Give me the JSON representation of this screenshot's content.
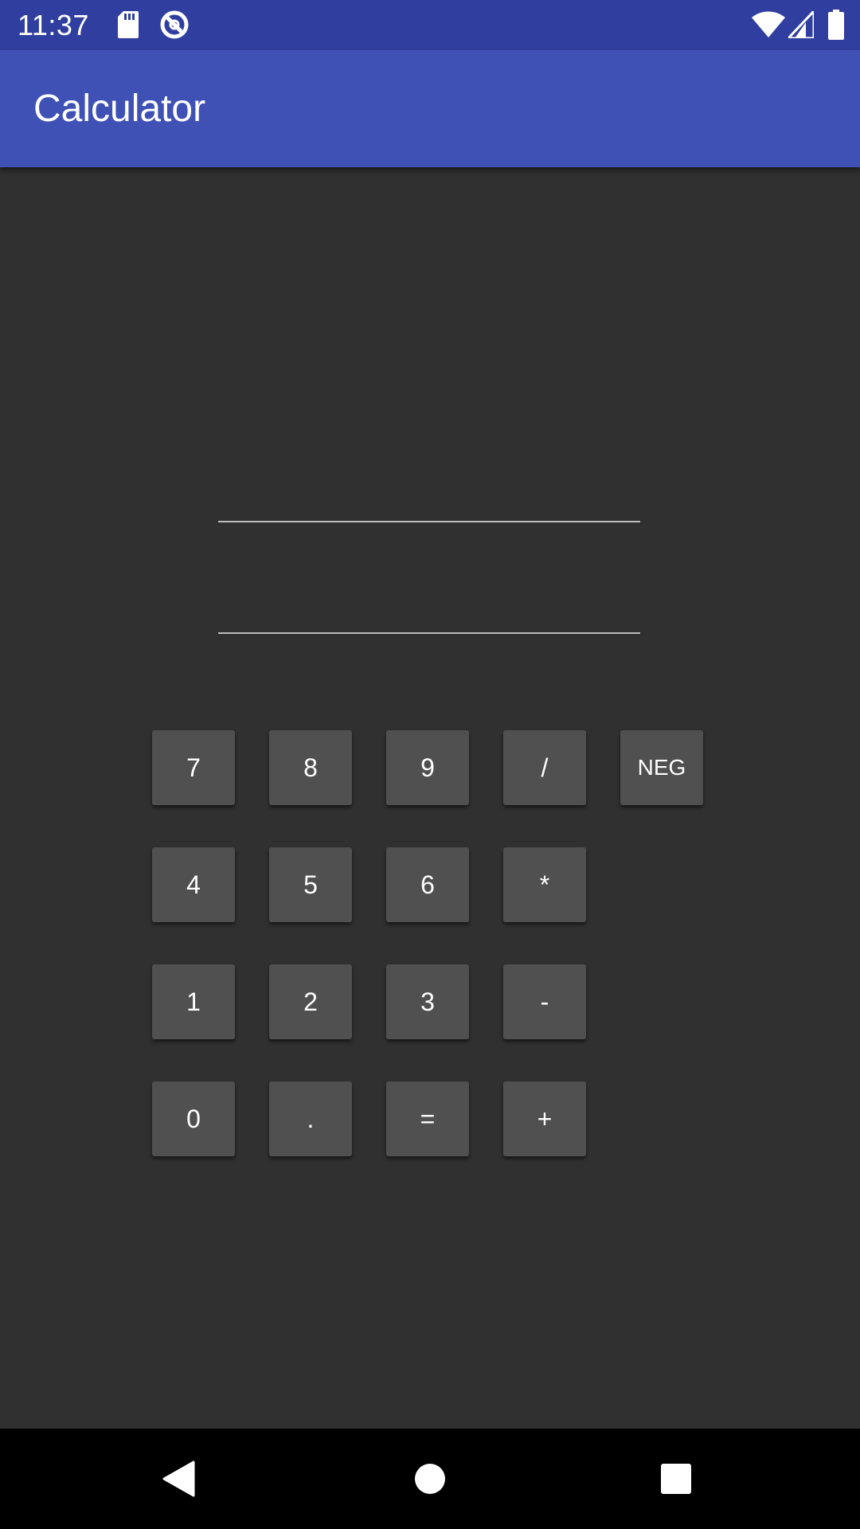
{
  "status_bar": {
    "time": "11:37",
    "icons": [
      "sd-card-icon",
      "do-not-disturb-icon",
      "wifi-icon",
      "cell-signal-icon",
      "battery-icon"
    ]
  },
  "app_bar": {
    "title": "Calculator"
  },
  "fields": {
    "first_value": "",
    "second_value": ""
  },
  "keypad": {
    "rows": [
      [
        "7",
        "8",
        "9",
        "/",
        "NEG"
      ],
      [
        "4",
        "5",
        "6",
        "*"
      ],
      [
        "1",
        "2",
        "3",
        "-"
      ],
      [
        "0",
        ".",
        "=",
        "+"
      ]
    ]
  },
  "nav_bar": {
    "icons": [
      "back-icon",
      "home-icon",
      "recents-icon"
    ]
  },
  "colors": {
    "status_bar": "#303f9f",
    "app_bar": "#3f51b5",
    "background": "#303030",
    "key": "#505050",
    "nav_bar": "#000000"
  }
}
